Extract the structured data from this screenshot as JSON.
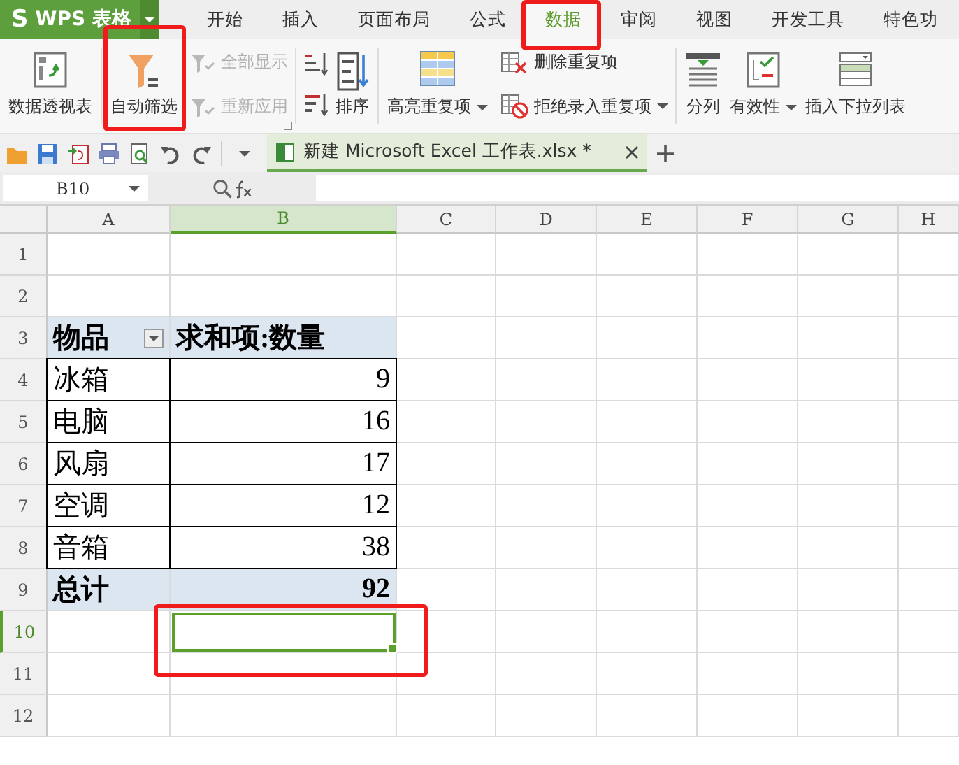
{
  "app_button": {
    "logo": "S",
    "label": "WPS 表格"
  },
  "tabs": [
    {
      "label": "开始",
      "selected": false,
      "highlighted": false
    },
    {
      "label": "插入",
      "selected": false,
      "highlighted": false
    },
    {
      "label": "页面布局",
      "selected": false,
      "highlighted": false
    },
    {
      "label": "公式",
      "selected": false,
      "highlighted": false
    },
    {
      "label": "数据",
      "selected": true,
      "highlighted": true
    },
    {
      "label": "审阅",
      "selected": false,
      "highlighted": false
    },
    {
      "label": "视图",
      "selected": false,
      "highlighted": false
    },
    {
      "label": "开发工具",
      "selected": false,
      "highlighted": false
    },
    {
      "label": "特色功",
      "selected": false,
      "highlighted": false
    }
  ],
  "ribbon": [
    {
      "launcher": false,
      "items": [
        {
          "kind": "large",
          "label": "数据透视表",
          "highlighted": false
        }
      ]
    },
    {
      "launcher": true,
      "items": [
        {
          "kind": "large",
          "label": "自动筛选",
          "highlighted": true
        },
        {
          "kind": "stack",
          "entries": [
            {
              "label": "全部显示",
              "disabled": true
            },
            {
              "label": "重新应用",
              "disabled": true
            }
          ]
        }
      ]
    },
    {
      "launcher": false,
      "items": [
        {
          "kind": "sort-pair"
        },
        {
          "kind": "large",
          "label": "排序",
          "highlighted": false
        }
      ]
    },
    {
      "launcher": false,
      "items": [
        {
          "kind": "large",
          "label": "高亮重复项",
          "dropdown": true,
          "highlighted": false
        },
        {
          "kind": "stack",
          "entries": [
            {
              "label": "删除重复项",
              "disabled": false
            },
            {
              "label": "拒绝录入重复项",
              "disabled": false,
              "dropdown": true
            }
          ]
        }
      ]
    },
    {
      "launcher": false,
      "items": [
        {
          "kind": "large",
          "label": "分列",
          "highlighted": false
        },
        {
          "kind": "large",
          "label": "有效性",
          "dropdown": true,
          "highlighted": false
        },
        {
          "kind": "large",
          "label": "插入下拉列表",
          "highlighted": false
        }
      ]
    }
  ],
  "document_tab": {
    "title": "新建 Microsoft Excel 工作表.xlsx *"
  },
  "formula_bar": {
    "name_box": "B10"
  },
  "sheet": {
    "columns": [
      {
        "label": "A",
        "selected": false
      },
      {
        "label": "B",
        "selected": true
      },
      {
        "label": "C",
        "selected": false
      },
      {
        "label": "D",
        "selected": false
      },
      {
        "label": "E",
        "selected": false
      },
      {
        "label": "F",
        "selected": false
      },
      {
        "label": "G",
        "selected": false
      },
      {
        "label": "H",
        "selected": false
      }
    ],
    "rows": [
      {
        "label": "1",
        "selected": false
      },
      {
        "label": "2",
        "selected": false
      },
      {
        "label": "3",
        "selected": false
      },
      {
        "label": "4",
        "selected": false
      },
      {
        "label": "5",
        "selected": false
      },
      {
        "label": "6",
        "selected": false
      },
      {
        "label": "7",
        "selected": false
      },
      {
        "label": "8",
        "selected": false
      },
      {
        "label": "9",
        "selected": false
      },
      {
        "label": "10",
        "selected": true
      },
      {
        "label": "11",
        "selected": false
      },
      {
        "label": "12",
        "selected": false
      }
    ],
    "selection_highlighted": true,
    "pivot": {
      "header": [
        "物品",
        "求和项:数量"
      ],
      "rows": [
        [
          "冰箱",
          "9"
        ],
        [
          "电脑",
          "16"
        ],
        [
          "风扇",
          "17"
        ],
        [
          "空调",
          "12"
        ],
        [
          "音箱",
          "38"
        ]
      ],
      "total": [
        "总计",
        "92"
      ]
    }
  }
}
